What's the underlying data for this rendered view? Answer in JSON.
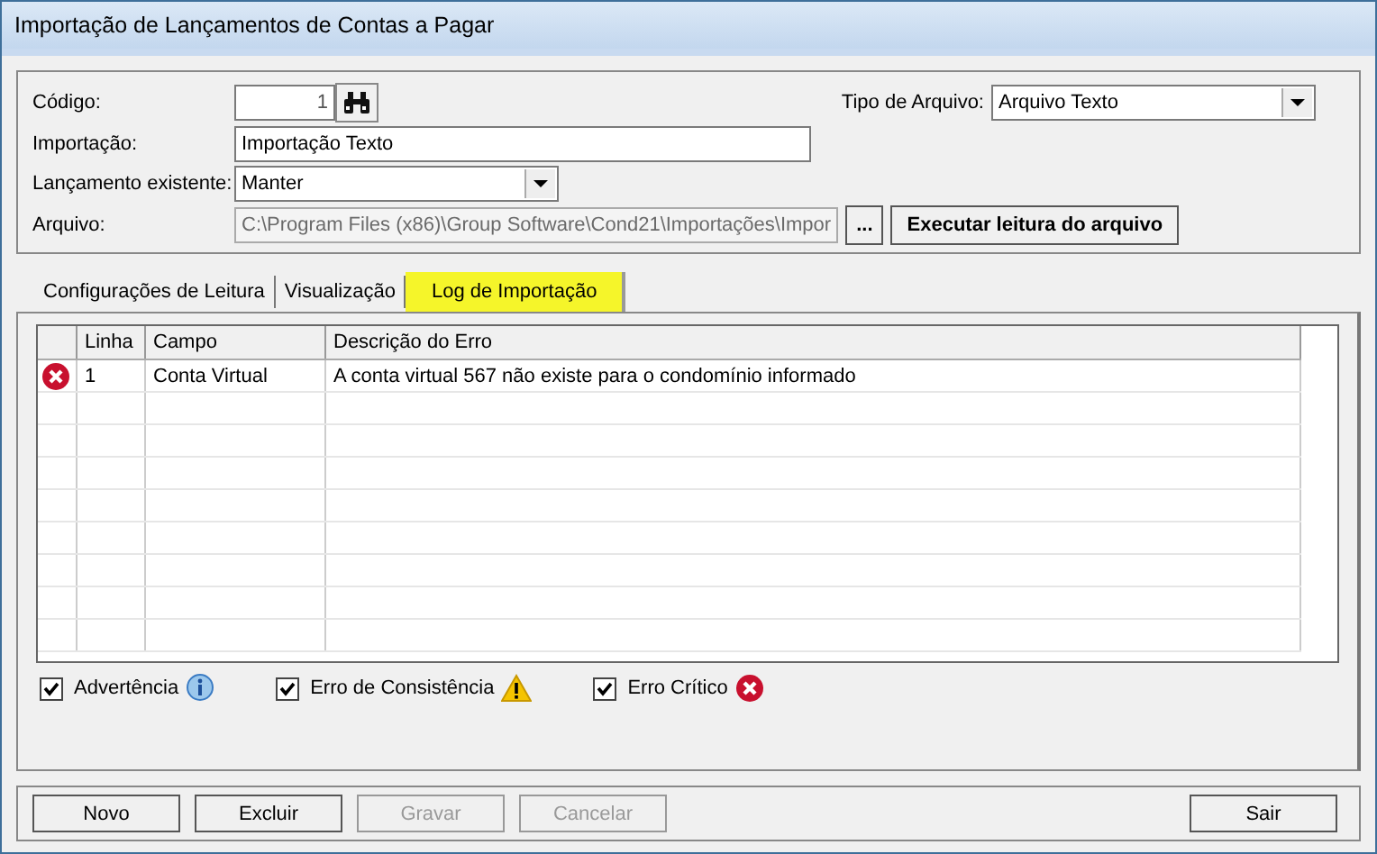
{
  "window": {
    "title": "Importação de Lançamentos de Contas a Pagar"
  },
  "form": {
    "codigo": {
      "label": "Código:",
      "value": "1"
    },
    "tipo": {
      "label": "Tipo de Arquivo:",
      "value": "Arquivo Texto"
    },
    "importacao": {
      "label": "Importação:",
      "value": "Importação Texto"
    },
    "lancamento": {
      "label": "Lançamento existente:",
      "value": "Manter"
    },
    "arquivo": {
      "label": "Arquivo:",
      "value": "C:\\Program Files (x86)\\Group Software\\Cond21\\Importações\\Impor",
      "disabled": true
    },
    "browse_button": "...",
    "read_button": "Executar leitura do arquivo"
  },
  "tabs": [
    {
      "label": "Configurações de Leitura",
      "selected": false
    },
    {
      "label": "Visualização",
      "selected": false
    },
    {
      "label": "Log de Importação",
      "selected": true
    }
  ],
  "table": {
    "columns": [
      "Linha",
      "Campo",
      "Descrição do Erro"
    ],
    "rows": [
      {
        "kind": "error",
        "linha": "1",
        "campo": "Conta Virtual",
        "descricao": "A conta virtual 567 não existe para o condomínio informado"
      }
    ]
  },
  "filters": [
    {
      "kind": "info",
      "label": "Advertência",
      "checked": true
    },
    {
      "kind": "warning",
      "label": "Erro de Consistência",
      "checked": true
    },
    {
      "kind": "error",
      "label": "Erro Crítico",
      "checked": true
    }
  ],
  "buttons": [
    {
      "label": "Novo",
      "disabled": false
    },
    {
      "label": "Excluir",
      "disabled": false
    },
    {
      "label": "Gravar",
      "disabled": true
    },
    {
      "label": "Cancelar",
      "disabled": true
    }
  ],
  "exit_button": {
    "label": "Sair",
    "disabled": false
  }
}
